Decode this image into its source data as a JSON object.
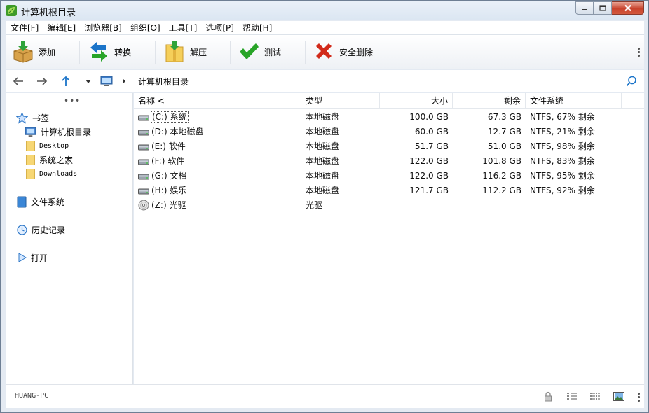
{
  "window": {
    "title": "计算机根目录"
  },
  "menu": [
    "文件[F]",
    "编辑[E]",
    "浏览器[B]",
    "组织[O]",
    "工具[T]",
    "选项[P]",
    "帮助[H]"
  ],
  "toolbar": {
    "add_label": "添加",
    "convert_label": "转换",
    "extract_label": "解压",
    "test_label": "测试",
    "delete_label": "安全删除"
  },
  "address": {
    "path": "计算机根目录"
  },
  "sidebar": {
    "bookmarks_label": "书签",
    "items": [
      "计算机根目录",
      "Desktop",
      "系统之家",
      "Downloads"
    ],
    "filesystem_label": "文件系统",
    "history_label": "历史记录",
    "open_label": "打开"
  },
  "table": {
    "columns": [
      "名称 <",
      "类型",
      "大小",
      "剩余",
      "文件系统"
    ],
    "rows": [
      {
        "name": "(C:) 系统",
        "type": "本地磁盘",
        "size": "100.0 GB",
        "free": "67.3 GB",
        "fs": "NTFS, 67% 剩余",
        "kind": "disk"
      },
      {
        "name": "(D:) 本地磁盘",
        "type": "本地磁盘",
        "size": "60.0 GB",
        "free": "12.7 GB",
        "fs": "NTFS, 21% 剩余",
        "kind": "disk"
      },
      {
        "name": "(E:) 软件",
        "type": "本地磁盘",
        "size": "51.7 GB",
        "free": "51.0 GB",
        "fs": "NTFS, 98% 剩余",
        "kind": "disk"
      },
      {
        "name": "(F:) 软件",
        "type": "本地磁盘",
        "size": "122.0 GB",
        "free": "101.8 GB",
        "fs": "NTFS, 83% 剩余",
        "kind": "disk"
      },
      {
        "name": "(G:) 文档",
        "type": "本地磁盘",
        "size": "122.0 GB",
        "free": "116.2 GB",
        "fs": "NTFS, 95% 剩余",
        "kind": "disk"
      },
      {
        "name": "(H:) 娱乐",
        "type": "本地磁盘",
        "size": "121.7 GB",
        "free": "112.2 GB",
        "fs": "NTFS, 92% 剩余",
        "kind": "disk"
      },
      {
        "name": "(Z:) 光驱",
        "type": "光驱",
        "size": "",
        "free": "",
        "fs": "",
        "kind": "optical"
      }
    ]
  },
  "status": {
    "computer_name": "HUANG-PC"
  },
  "icons": {
    "app": "leaf-icon",
    "add": "box-down-arrow-icon",
    "convert": "swap-arrows-icon",
    "extract": "folder-zip-icon",
    "test": "checkmark-icon",
    "delete": "red-x-icon"
  },
  "colors": {
    "accent": "#1b74c9",
    "check_green": "#28a428",
    "delete_red": "#d12a1a"
  }
}
